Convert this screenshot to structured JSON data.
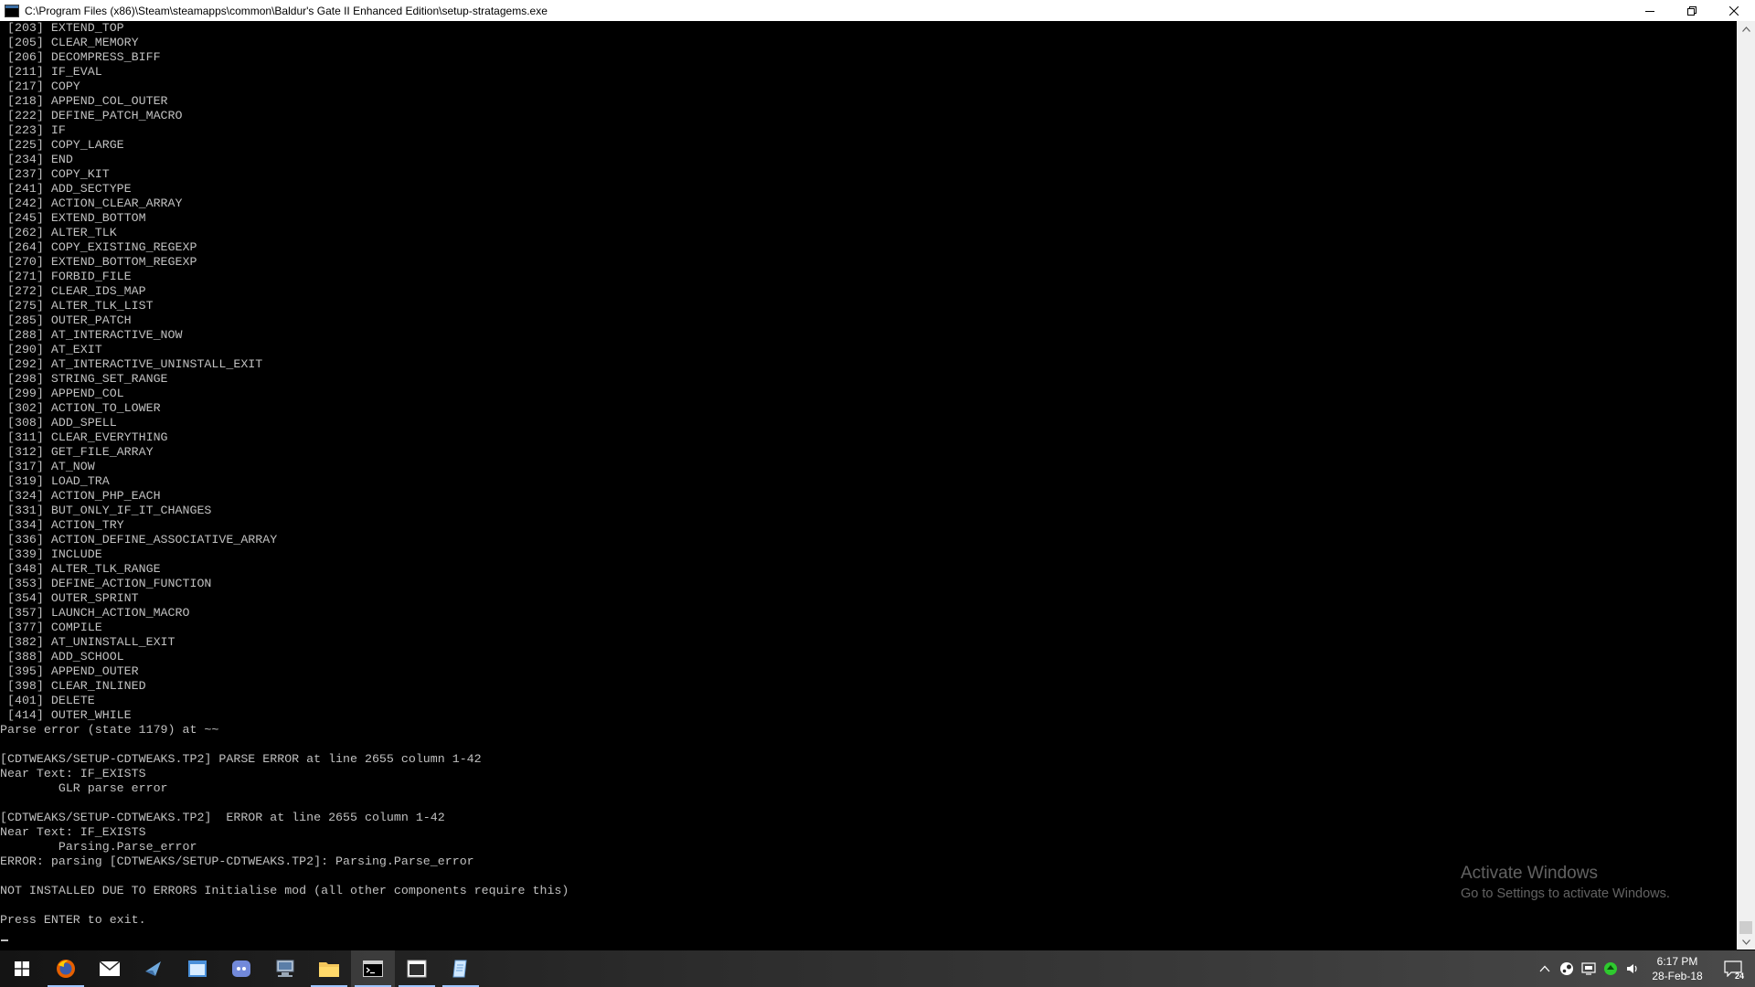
{
  "window": {
    "title": "C:\\Program Files (x86)\\Steam\\steamapps\\common\\Baldur's Gate II Enhanced Edition\\setup-stratagems.exe"
  },
  "console": {
    "lines": [
      " [203] EXTEND_TOP",
      " [205] CLEAR_MEMORY",
      " [206] DECOMPRESS_BIFF",
      " [211] IF_EVAL",
      " [217] COPY",
      " [218] APPEND_COL_OUTER",
      " [222] DEFINE_PATCH_MACRO",
      " [223] IF",
      " [225] COPY_LARGE",
      " [234] END",
      " [237] COPY_KIT",
      " [241] ADD_SECTYPE",
      " [242] ACTION_CLEAR_ARRAY",
      " [245] EXTEND_BOTTOM",
      " [262] ALTER_TLK",
      " [264] COPY_EXISTING_REGEXP",
      " [270] EXTEND_BOTTOM_REGEXP",
      " [271] FORBID_FILE",
      " [272] CLEAR_IDS_MAP",
      " [275] ALTER_TLK_LIST",
      " [285] OUTER_PATCH",
      " [288] AT_INTERACTIVE_NOW",
      " [290] AT_EXIT",
      " [292] AT_INTERACTIVE_UNINSTALL_EXIT",
      " [298] STRING_SET_RANGE",
      " [299] APPEND_COL",
      " [302] ACTION_TO_LOWER",
      " [308] ADD_SPELL",
      " [311] CLEAR_EVERYTHING",
      " [312] GET_FILE_ARRAY",
      " [317] AT_NOW",
      " [319] LOAD_TRA",
      " [324] ACTION_PHP_EACH",
      " [331] BUT_ONLY_IF_IT_CHANGES",
      " [334] ACTION_TRY",
      " [336] ACTION_DEFINE_ASSOCIATIVE_ARRAY",
      " [339] INCLUDE",
      " [348] ALTER_TLK_RANGE",
      " [353] DEFINE_ACTION_FUNCTION",
      " [354] OUTER_SPRINT",
      " [357] LAUNCH_ACTION_MACRO",
      " [377] COMPILE",
      " [382] AT_UNINSTALL_EXIT",
      " [388] ADD_SCHOOL",
      " [395] APPEND_OUTER",
      " [398] CLEAR_INLINED",
      " [401] DELETE",
      " [414] OUTER_WHILE",
      "Parse error (state 1179) at ~~",
      "",
      "[CDTWEAKS/SETUP-CDTWEAKS.TP2] PARSE ERROR at line 2655 column 1-42",
      "Near Text: IF_EXISTS",
      "        GLR parse error",
      "",
      "[CDTWEAKS/SETUP-CDTWEAKS.TP2]  ERROR at line 2655 column 1-42",
      "Near Text: IF_EXISTS",
      "        Parsing.Parse_error",
      "ERROR: parsing [CDTWEAKS/SETUP-CDTWEAKS.TP2]: Parsing.Parse_error",
      "",
      "NOT INSTALLED DUE TO ERRORS Initialise mod (all other components require this)",
      "",
      "Press ENTER to exit."
    ]
  },
  "watermark": {
    "title": "Activate Windows",
    "subtitle": "Go to Settings to activate Windows."
  },
  "taskbar": {
    "apps": [
      "start-icon",
      "firefox-icon",
      "mail-icon",
      "bird-app-icon",
      "window-app-icon",
      "discord-icon",
      "network-app-icon",
      "file-explorer-icon",
      "console-icon",
      "window-frame-icon",
      "notepad-icon"
    ],
    "clock_time": "6:17 PM",
    "clock_date": "28-Feb-18",
    "notification_count": "24"
  },
  "colors": {
    "console_bg": "#000000",
    "console_text": "#c0c0c0",
    "titlebar_bg": "#ffffff"
  }
}
